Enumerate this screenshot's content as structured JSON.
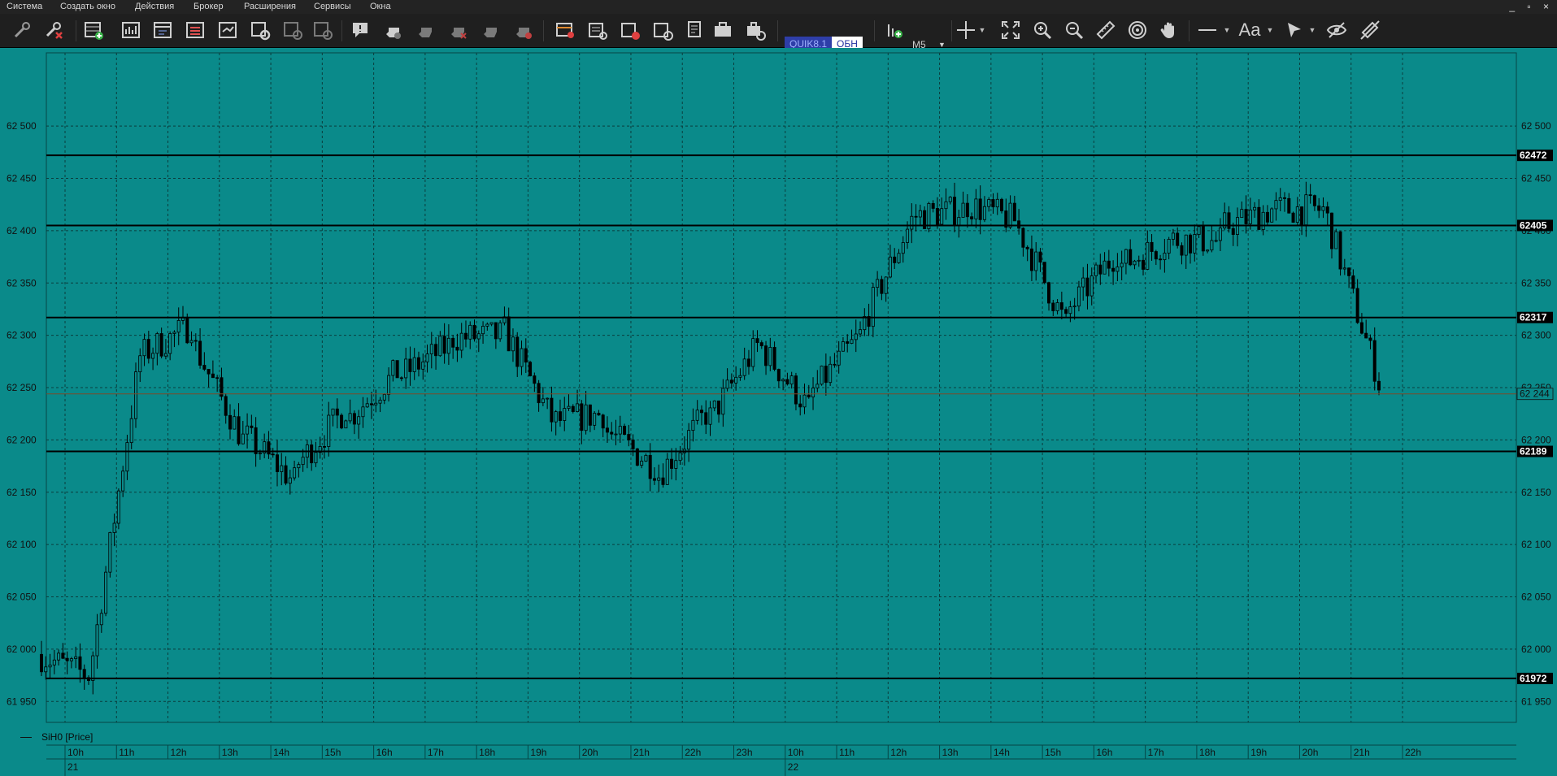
{
  "menu": [
    "Система",
    "Создать окно",
    "Действия",
    "Брокер",
    "Расширения",
    "Сервисы",
    "Окна"
  ],
  "window_controls": "_ ▫ ×",
  "toolbar": {
    "quik_label": "QUIK8.1",
    "quik_value": "ОБН",
    "timeframe": "M5"
  },
  "chart_data": {
    "type": "candlestick",
    "series_label": "SiH0 [Price]",
    "ylim": [
      61930,
      62570
    ],
    "y_ticks": [
      61950,
      62000,
      62050,
      62100,
      62150,
      62200,
      62250,
      62300,
      62350,
      62400,
      62450,
      62500
    ],
    "y_tick_labels": [
      "61 950",
      "62 000",
      "62 050",
      "62 100",
      "62 150",
      "62 200",
      "62 250",
      "62 300",
      "62 350",
      "62 400",
      "62 450",
      "62 500"
    ],
    "hlines": [
      {
        "value": 62472,
        "label": "62472"
      },
      {
        "value": 62405,
        "label": "62405"
      },
      {
        "value": 62317,
        "label": "62317"
      },
      {
        "value": 62189,
        "label": "62189"
      },
      {
        "value": 61972,
        "label": "61972"
      }
    ],
    "last_price": {
      "value": 62244,
      "label": "62 244"
    },
    "time_labels": [
      "10h",
      "11h",
      "12h",
      "13h",
      "14h",
      "15h",
      "16h",
      "17h",
      "18h",
      "19h",
      "20h",
      "21h",
      "22h",
      "23h",
      "10h",
      "11h",
      "12h",
      "13h",
      "14h",
      "15h",
      "16h",
      "17h",
      "18h",
      "19h",
      "20h",
      "21h",
      "22h"
    ],
    "day_labels": [
      {
        "label": "21",
        "index": 0
      },
      {
        "label": "22",
        "index": 14
      }
    ],
    "hour_closes": [
      61975,
      62280,
      62310,
      62200,
      62160,
      62230,
      62265,
      62290,
      62300,
      62220,
      62225,
      62175,
      62225,
      62290,
      62230,
      62300,
      62410,
      62420,
      62410,
      62310,
      62380,
      62390,
      62390,
      62420,
      62420,
      62270,
      62244
    ]
  }
}
